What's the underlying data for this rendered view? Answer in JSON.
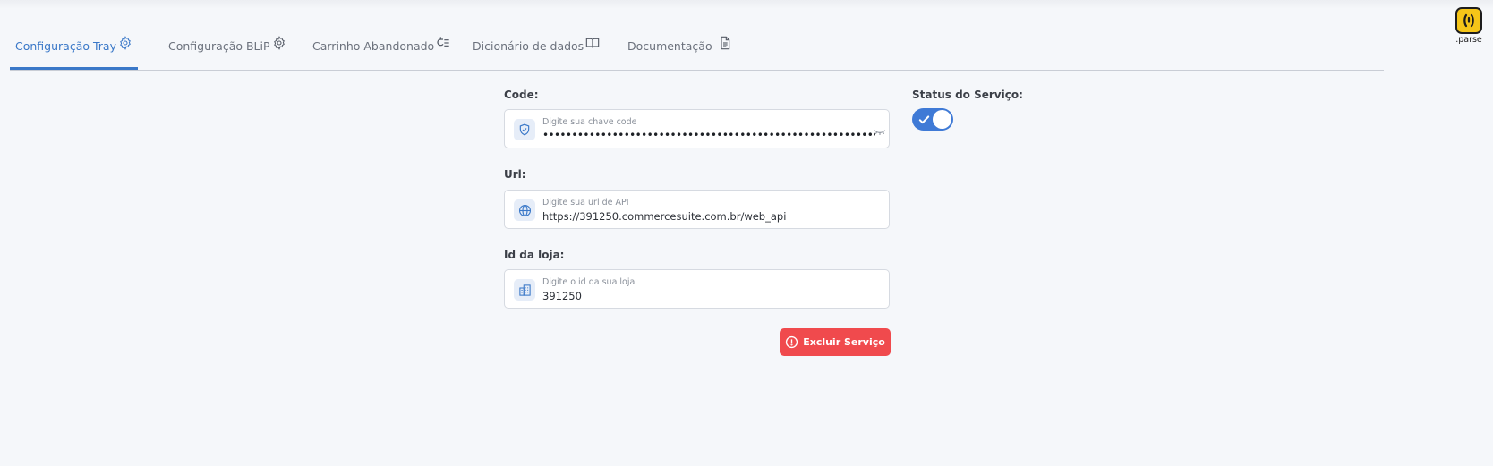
{
  "tabs": [
    {
      "label": "Configuração Tray",
      "icon": "gear-icon",
      "active": true
    },
    {
      "label": "Configuração BLiP",
      "icon": "gear-icon",
      "active": false
    },
    {
      "label": "Carrinho Abandonado",
      "icon": "refresh-list-icon",
      "active": false
    },
    {
      "label": "Dicionário de dados",
      "icon": "book-icon",
      "active": false
    },
    {
      "label": "Documentação",
      "icon": "document-icon",
      "active": false
    }
  ],
  "brand": {
    "name": ".parse",
    "color": "#f5c518"
  },
  "form": {
    "code": {
      "label": "Code:",
      "placeholder": "Digite sua chave code",
      "value": "••••••••••••••••••••••••••••••••••••••••••••••••••••••••••••",
      "icon": "shield-check-icon"
    },
    "url": {
      "label": "Url:",
      "placeholder": "Digite sua url de API",
      "value": "https://391250.commercesuite.com.br/web_api",
      "icon": "globe-icon"
    },
    "store_id": {
      "label": "Id da loja:",
      "placeholder": "Digite o id da sua loja",
      "value": "391250",
      "icon": "building-icon"
    }
  },
  "service_status": {
    "label": "Status do Serviço:",
    "enabled": true
  },
  "delete_button": {
    "label": "Excluir Serviço",
    "icon": "alert-circle-icon",
    "color": "#f04a4d"
  },
  "colors": {
    "accent": "#3a78c8",
    "toggle": "#3f7ad6",
    "danger": "#f04a4d"
  }
}
